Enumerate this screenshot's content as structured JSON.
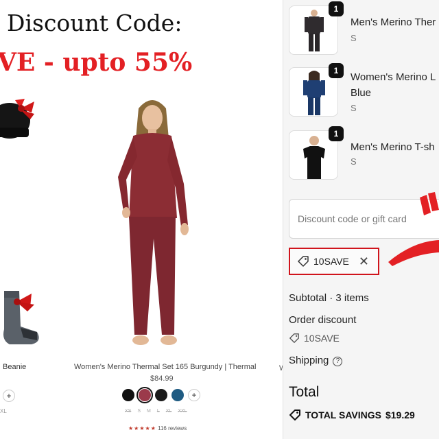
{
  "promo": {
    "title": "Discount Code:",
    "code_fragment": "VE",
    "offer": " - upto 55%"
  },
  "products": {
    "beanie_name_fragment": "Beanie",
    "beanie_add": "+",
    "beanie_size_fragment": "XL",
    "main": {
      "name": "Women's Merino Thermal Set 165 Burgundy | Thermal",
      "price": "$84.99",
      "swatches": [
        {
          "color": "#111111",
          "selected": false
        },
        {
          "color": "#9b3a4b",
          "selected": true
        },
        {
          "color": "#1b1b1b",
          "selected": false
        },
        {
          "color": "#1f5b82",
          "selected": false
        }
      ],
      "more": "+",
      "sizes": [
        {
          "label": "XS",
          "available": false
        },
        {
          "label": "S",
          "available": true
        },
        {
          "label": "M",
          "available": true
        },
        {
          "label": "L",
          "available": false
        },
        {
          "label": "XL",
          "available": false
        },
        {
          "label": "XXL",
          "available": false
        }
      ],
      "stars": "★★★★★",
      "reviews": "116 reviews"
    },
    "edge_fragment": "W"
  },
  "cart": {
    "items": [
      {
        "qty": "1",
        "name": "Men's Merino Ther",
        "name2": "",
        "variant": "S"
      },
      {
        "qty": "1",
        "name": "Women's Merino L",
        "name2": "Blue",
        "variant": "S"
      },
      {
        "qty": "1",
        "name": "Men's Merino T-sh",
        "name2": "",
        "variant": "S"
      }
    ],
    "discount_placeholder": "Discount code or gift card",
    "applied_code": "10SAVE",
    "subtotal_label": "Subtotal · 3 items",
    "order_discount_label": "Order discount",
    "order_discount_code": "10SAVE",
    "shipping_label": "Shipping",
    "total_label": "Total",
    "total_savings_label": "TOTAL SAVINGS",
    "total_savings_value": "$19.29"
  },
  "colors": {
    "accent_red": "#e32024",
    "chip_border": "#d0141c",
    "panel_bg": "#f5f5f5"
  }
}
